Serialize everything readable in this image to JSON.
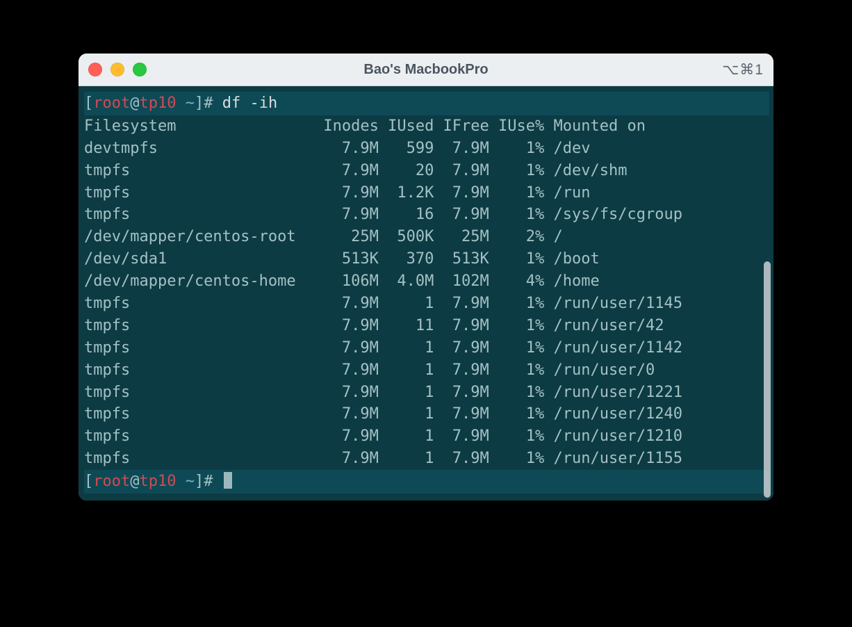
{
  "window": {
    "title": "Bao's MacbookPro",
    "shortcut": "⌥⌘1"
  },
  "prompt": {
    "user": "root",
    "host": "tp10",
    "path": "~",
    "symbol": "#",
    "command": "df -ih"
  },
  "columns": [
    "Filesystem",
    "Inodes",
    "IUsed",
    "IFree",
    "IUse%",
    "Mounted on"
  ],
  "col_widths": {
    "fs": 25,
    "inodes": 7,
    "iused": 6,
    "ifree": 6,
    "iusep": 6,
    "mount": 0
  },
  "rows": [
    {
      "fs": "devtmpfs",
      "inodes": "7.9M",
      "iused": "599",
      "ifree": "7.9M",
      "iusep": "1%",
      "mount": "/dev"
    },
    {
      "fs": "tmpfs",
      "inodes": "7.9M",
      "iused": "20",
      "ifree": "7.9M",
      "iusep": "1%",
      "mount": "/dev/shm"
    },
    {
      "fs": "tmpfs",
      "inodes": "7.9M",
      "iused": "1.2K",
      "ifree": "7.9M",
      "iusep": "1%",
      "mount": "/run"
    },
    {
      "fs": "tmpfs",
      "inodes": "7.9M",
      "iused": "16",
      "ifree": "7.9M",
      "iusep": "1%",
      "mount": "/sys/fs/cgroup"
    },
    {
      "fs": "/dev/mapper/centos-root",
      "inodes": "25M",
      "iused": "500K",
      "ifree": "25M",
      "iusep": "2%",
      "mount": "/"
    },
    {
      "fs": "/dev/sda1",
      "inodes": "513K",
      "iused": "370",
      "ifree": "513K",
      "iusep": "1%",
      "mount": "/boot"
    },
    {
      "fs": "/dev/mapper/centos-home",
      "inodes": "106M",
      "iused": "4.0M",
      "ifree": "102M",
      "iusep": "4%",
      "mount": "/home"
    },
    {
      "fs": "tmpfs",
      "inodes": "7.9M",
      "iused": "1",
      "ifree": "7.9M",
      "iusep": "1%",
      "mount": "/run/user/1145"
    },
    {
      "fs": "tmpfs",
      "inodes": "7.9M",
      "iused": "11",
      "ifree": "7.9M",
      "iusep": "1%",
      "mount": "/run/user/42"
    },
    {
      "fs": "tmpfs",
      "inodes": "7.9M",
      "iused": "1",
      "ifree": "7.9M",
      "iusep": "1%",
      "mount": "/run/user/1142"
    },
    {
      "fs": "tmpfs",
      "inodes": "7.9M",
      "iused": "1",
      "ifree": "7.9M",
      "iusep": "1%",
      "mount": "/run/user/0"
    },
    {
      "fs": "tmpfs",
      "inodes": "7.9M",
      "iused": "1",
      "ifree": "7.9M",
      "iusep": "1%",
      "mount": "/run/user/1221"
    },
    {
      "fs": "tmpfs",
      "inodes": "7.9M",
      "iused": "1",
      "ifree": "7.9M",
      "iusep": "1%",
      "mount": "/run/user/1240"
    },
    {
      "fs": "tmpfs",
      "inodes": "7.9M",
      "iused": "1",
      "ifree": "7.9M",
      "iusep": "1%",
      "mount": "/run/user/1210"
    },
    {
      "fs": "tmpfs",
      "inodes": "7.9M",
      "iused": "1",
      "ifree": "7.9M",
      "iusep": "1%",
      "mount": "/run/user/1155"
    }
  ]
}
